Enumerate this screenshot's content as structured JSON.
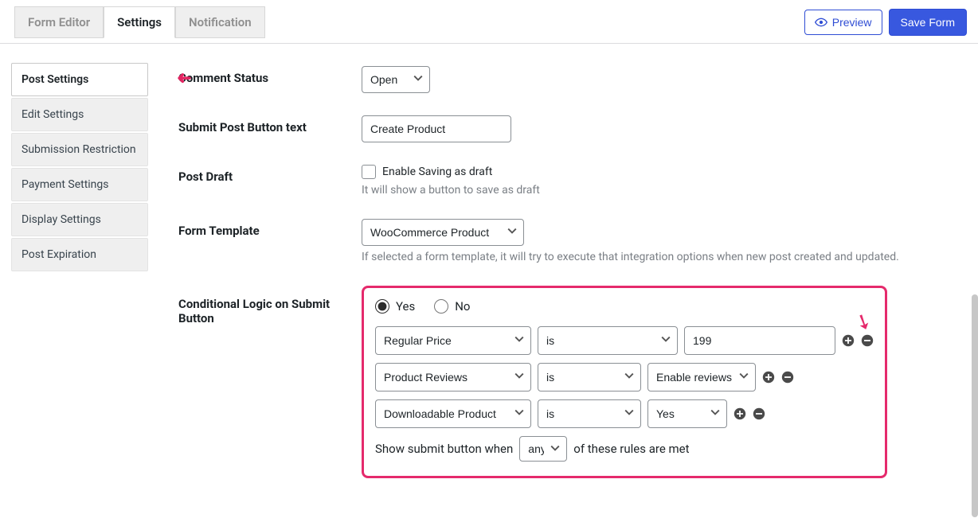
{
  "header": {
    "tabs": [
      "Form Editor",
      "Settings",
      "Notification"
    ],
    "activeTab": "Settings",
    "previewLabel": "Preview",
    "saveLabel": "Save Form"
  },
  "sidebar": {
    "items": [
      "Post Settings",
      "Edit Settings",
      "Submission Restriction",
      "Payment Settings",
      "Display Settings",
      "Post Expiration"
    ],
    "activeIndex": 0
  },
  "settings": {
    "commentStatus": {
      "label": "Comment Status",
      "value": "Open"
    },
    "submitButtonText": {
      "label": "Submit Post Button text",
      "value": "Create Product"
    },
    "postDraft": {
      "label": "Post Draft",
      "checkLabel": "Enable Saving as draft",
      "help": "It will show a button to save as draft",
      "checked": false
    },
    "formTemplate": {
      "label": "Form Template",
      "value": "WooCommerce Product",
      "help": "If selected a form template, it will try to execute that integration options when new post created and updated."
    },
    "conditional": {
      "label": "Conditional Logic on Submit Button",
      "yesLabel": "Yes",
      "noLabel": "No",
      "enabled": "Yes",
      "rows": [
        {
          "field": "Regular Price",
          "op": "is",
          "value": "199",
          "valueIsSelect": false
        },
        {
          "field": "Product Reviews",
          "op": "is",
          "value": "Enable reviews",
          "valueIsSelect": true
        },
        {
          "field": "Downloadable Product",
          "op": "is",
          "value": "Yes",
          "valueIsSelect": true
        }
      ],
      "footerPre": "Show submit button when",
      "match": "any",
      "footerPost": "of these rules are met"
    }
  }
}
